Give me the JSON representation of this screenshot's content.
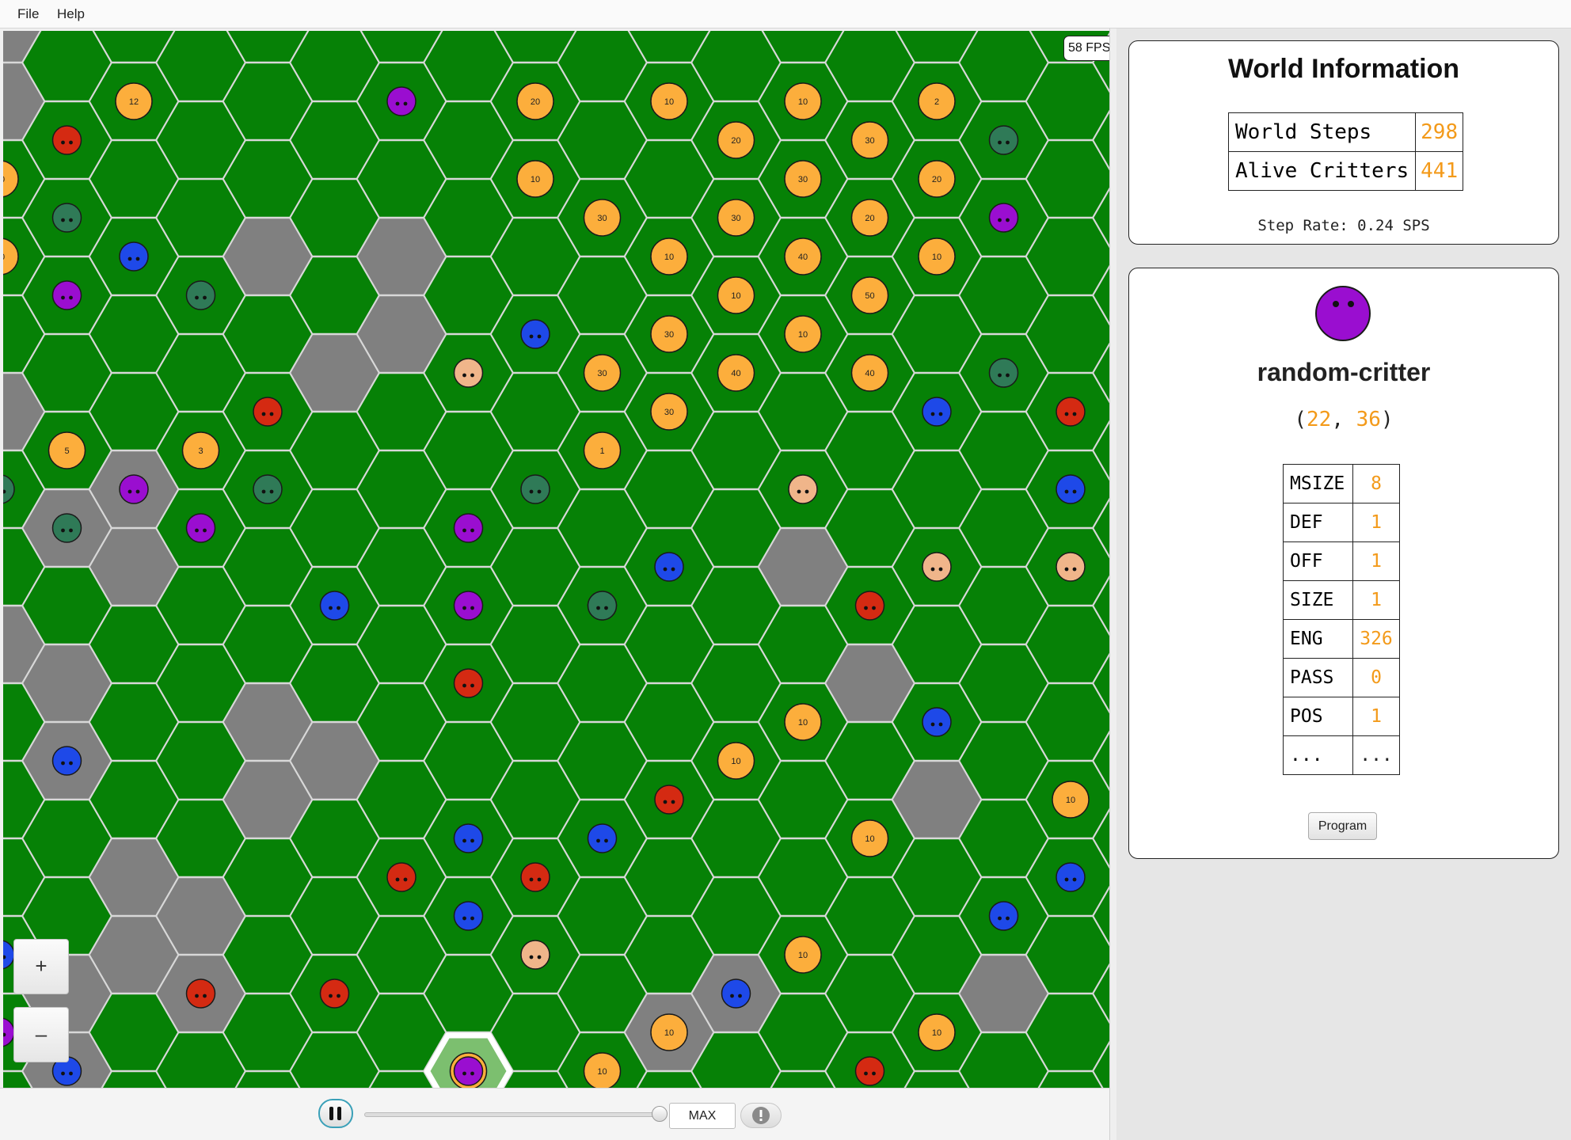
{
  "menu": {
    "file": "File",
    "help": "Help"
  },
  "world_view": {
    "fps_label": "58 FPS",
    "zoom_in": "+",
    "zoom_out": "–",
    "rock_color": "#808080",
    "grass_color": "#068106",
    "selected_cell": [
      7,
      13
    ]
  },
  "controls": {
    "speed_label": "MAX",
    "pause_icon": "pause-icon",
    "info_icon": "alert-icon",
    "slider_fraction": 1.0
  },
  "world_info": {
    "title": "World Information",
    "rows": [
      {
        "label": "World Steps",
        "value": "298"
      },
      {
        "label": "Alive Critters",
        "value": "441"
      }
    ],
    "step_rate_label": "Step Rate: ",
    "step_rate_value": "0.24 SPS"
  },
  "critter": {
    "name": "random-critter",
    "pos_open": "(",
    "pos_sep": ", ",
    "pos_close": ")",
    "x": "22",
    "y": "36",
    "color": "#9a0ed0",
    "stats": [
      {
        "label": "MSIZE",
        "value": "8"
      },
      {
        "label": "DEF",
        "value": "1"
      },
      {
        "label": "OFF",
        "value": "1"
      },
      {
        "label": "SIZE",
        "value": "1"
      },
      {
        "label": "ENG",
        "value": "326"
      },
      {
        "label": "PASS",
        "value": "0"
      },
      {
        "label": "POS",
        "value": "1"
      },
      {
        "label": "...",
        "value": "..."
      }
    ],
    "program_button": "Program"
  },
  "grid": {
    "rocks": [
      [
        0,
        0
      ],
      [
        0,
        1
      ],
      [
        0,
        5
      ],
      [
        0,
        8
      ],
      [
        1,
        6
      ],
      [
        1,
        8
      ],
      [
        1,
        9
      ],
      [
        1,
        12
      ],
      [
        1,
        13
      ],
      [
        2,
        6
      ],
      [
        2,
        7
      ],
      [
        2,
        11
      ],
      [
        2,
        12
      ],
      [
        4,
        3
      ],
      [
        5,
        4
      ],
      [
        3,
        11
      ],
      [
        3,
        12
      ],
      [
        4,
        16
      ],
      [
        0,
        17
      ],
      [
        0,
        18
      ],
      [
        2,
        18
      ],
      [
        7,
        30
      ],
      [
        1,
        28
      ],
      [
        1,
        26
      ],
      [
        2,
        27
      ],
      [
        3,
        28
      ],
      [
        2,
        30
      ],
      [
        0,
        30
      ],
      [
        10,
        21
      ],
      [
        11,
        20
      ],
      [
        10,
        32
      ],
      [
        11,
        32
      ],
      [
        11,
        31
      ],
      [
        12,
        30
      ],
      [
        13,
        29
      ],
      [
        13,
        30
      ],
      [
        14,
        32
      ],
      [
        15,
        33
      ],
      [
        15,
        30
      ],
      [
        14,
        29
      ],
      [
        13,
        27
      ],
      [
        4,
        26
      ],
      [
        5,
        25
      ],
      [
        5,
        31
      ],
      [
        1,
        32
      ],
      [
        4,
        9
      ],
      [
        4,
        10
      ],
      [
        5,
        9
      ],
      [
        6,
        4
      ],
      [
        6,
        3
      ],
      [
        10,
        13
      ],
      [
        11,
        12
      ],
      [
        15,
        25
      ],
      [
        14,
        24
      ],
      [
        15,
        12
      ],
      [
        12,
        7
      ],
      [
        13,
        8
      ],
      [
        14,
        10
      ],
      [
        15,
        14
      ],
      [
        15,
        15
      ],
      [
        16,
        16
      ],
      [
        16,
        20
      ],
      [
        16,
        21
      ],
      [
        16,
        22
      ]
    ],
    "critters": [
      [
        2,
        2,
        "red"
      ],
      [
        2,
        4,
        "teal"
      ],
      [
        0,
        4,
        "orange",
        "10"
      ],
      [
        2,
        6,
        "purple"
      ],
      [
        4,
        5,
        "blue"
      ],
      [
        5,
        6,
        "teal"
      ],
      [
        2,
        10,
        "orange",
        "5"
      ],
      [
        0,
        11,
        "teal"
      ],
      [
        2,
        12,
        "teal"
      ],
      [
        3,
        12,
        "purple"
      ],
      [
        6,
        10,
        "orange",
        "3"
      ],
      [
        8,
        9,
        "red"
      ],
      [
        8,
        11,
        "teal"
      ],
      [
        6,
        12,
        "purple"
      ],
      [
        10,
        14,
        "blue"
      ],
      [
        14,
        8,
        "peach"
      ],
      [
        16,
        7,
        "blue"
      ],
      [
        14,
        12,
        "purple"
      ],
      [
        14,
        14,
        "purple"
      ],
      [
        16,
        11,
        "teal"
      ],
      [
        18,
        13,
        "teal"
      ],
      [
        14,
        16,
        "red"
      ],
      [
        16,
        7,
        "blue"
      ],
      [
        18,
        8,
        "orange",
        "30"
      ],
      [
        18,
        10,
        "orange",
        "1"
      ],
      [
        20,
        9,
        "orange",
        "30"
      ],
      [
        20,
        7,
        "orange",
        "30"
      ],
      [
        20,
        5,
        "orange",
        "10"
      ],
      [
        22,
        6,
        "orange",
        "10"
      ],
      [
        22,
        8,
        "orange",
        "40"
      ],
      [
        20,
        9,
        "orange",
        "20"
      ],
      [
        18,
        4,
        "orange",
        "30"
      ],
      [
        16,
        3,
        "orange",
        "10"
      ],
      [
        16,
        1,
        "orange",
        "20"
      ],
      [
        20,
        1,
        "orange",
        "10"
      ],
      [
        22,
        2,
        "orange",
        "20"
      ],
      [
        24,
        1,
        "orange",
        "10"
      ],
      [
        24,
        3,
        "orange",
        "30"
      ],
      [
        26,
        2,
        "orange",
        "30"
      ],
      [
        26,
        4,
        "orange",
        "20"
      ],
      [
        24,
        5,
        "orange",
        "40"
      ],
      [
        26,
        6,
        "orange",
        "50"
      ],
      [
        24,
        7,
        "orange",
        "10"
      ],
      [
        26,
        8,
        "orange",
        "40"
      ],
      [
        22,
        4,
        "orange",
        "30"
      ],
      [
        28,
        3,
        "orange",
        "20"
      ],
      [
        28,
        1,
        "orange",
        "2"
      ],
      [
        28,
        5,
        "orange",
        "10"
      ],
      [
        30,
        2,
        "teal"
      ],
      [
        30,
        4,
        "purple"
      ],
      [
        30,
        8,
        "teal"
      ],
      [
        28,
        9,
        "blue"
      ],
      [
        32,
        9,
        "red"
      ],
      [
        32,
        11,
        "blue"
      ],
      [
        24,
        11,
        "peach"
      ],
      [
        20,
        13,
        "blue"
      ],
      [
        18,
        14,
        "teal"
      ],
      [
        26,
        14,
        "red"
      ],
      [
        28,
        13,
        "peach"
      ],
      [
        32,
        13,
        "peach"
      ],
      [
        14,
        16,
        "red"
      ],
      [
        24,
        17,
        "orange",
        "10"
      ],
      [
        22,
        18,
        "orange",
        "10"
      ],
      [
        28,
        17,
        "blue"
      ],
      [
        20,
        19,
        "red"
      ],
      [
        32,
        19,
        "orange",
        "10"
      ],
      [
        26,
        20,
        "orange",
        "10"
      ],
      [
        32,
        21,
        "blue"
      ],
      [
        30,
        22,
        "blue"
      ],
      [
        14,
        20,
        "blue"
      ],
      [
        18,
        20,
        "blue"
      ],
      [
        12,
        21,
        "red"
      ],
      [
        16,
        21,
        "red"
      ],
      [
        14,
        22,
        "blue"
      ],
      [
        16,
        23,
        "peach"
      ],
      [
        24,
        23,
        "orange",
        "10"
      ],
      [
        22,
        24,
        "blue"
      ],
      [
        20,
        25,
        "orange",
        "10"
      ],
      [
        28,
        25,
        "orange",
        "10"
      ],
      [
        26,
        26,
        "red"
      ],
      [
        14,
        26,
        "orange",
        "20"
      ],
      [
        18,
        26,
        "orange",
        "10"
      ],
      [
        20,
        27,
        "orange",
        "10"
      ],
      [
        16,
        27,
        "purple"
      ],
      [
        24,
        27,
        "peach"
      ],
      [
        8,
        27,
        "red"
      ],
      [
        6,
        24,
        "red"
      ],
      [
        10,
        24,
        "red"
      ],
      [
        2,
        18,
        "blue"
      ],
      [
        0,
        23,
        "blue"
      ],
      [
        0,
        25,
        "purple"
      ],
      [
        2,
        26,
        "blue"
      ],
      [
        4,
        5,
        "blue"
      ],
      [
        0,
        5,
        "orange",
        "10"
      ],
      [
        4,
        1,
        "orange",
        "12"
      ],
      [
        12,
        1,
        "purple"
      ],
      [
        16,
        1,
        "orange",
        "20"
      ]
    ]
  }
}
